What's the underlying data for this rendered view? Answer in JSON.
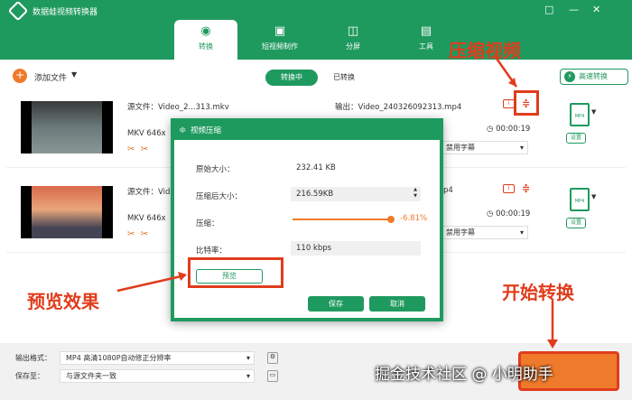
{
  "app": {
    "title": "数据蛙视频转换器",
    "window_icons": [
      "□",
      "—",
      "✕"
    ]
  },
  "tabs": [
    {
      "label": "转换",
      "icon": "convert-icon"
    },
    {
      "label": "短视频制作",
      "icon": "video-icon"
    },
    {
      "label": "分屏",
      "icon": "split-icon"
    },
    {
      "label": "工具",
      "icon": "toolbox-icon"
    }
  ],
  "toolbar": {
    "add": "添加文件",
    "converting": "转换中",
    "converted": "已转换",
    "fast": "高速转换"
  },
  "items": [
    {
      "source": "源文件：Video_2...313.mkv",
      "info": "MKV  646x",
      "output": "输出：Video_240326092313.mp4",
      "duration": "00:00:19",
      "subtitle": "禁用字幕",
      "fmt": "MP4",
      "settings": "设置"
    },
    {
      "source": "源文件：Vide",
      "info": "MKV  646x",
      "output": "p4",
      "duration": "00:00:19",
      "subtitle": "禁用字幕",
      "fmt": "MP4",
      "settings": "设置"
    }
  ],
  "footer": {
    "format_label": "输出格式：",
    "format_value": "MP4 高清1080P自动修正分辨率",
    "save_label": "保存至：",
    "save_value": "与源文件夹一致"
  },
  "dialog": {
    "title": "视频压缩",
    "orig_label": "原始大小：",
    "orig_value": "232.41 KB",
    "after_label": "压缩后大小：",
    "after_value": "216.59KB",
    "comp_label": "压缩：",
    "comp_value": "-6.81%",
    "comp_fraction": 0.93,
    "bitrate_label": "比特率：",
    "bitrate_value": "110 kbps",
    "preview": "预览",
    "save": "保存",
    "cancel": "取消"
  },
  "annotations": {
    "compress": "压缩视频",
    "preview": "预览效果",
    "start": "开始转换"
  },
  "watermark": "掘金技术社区 @ 小明助手",
  "colors": {
    "brand": "#1f9a5f",
    "accent": "#f07a2b",
    "annotation": "#e03c1c"
  }
}
